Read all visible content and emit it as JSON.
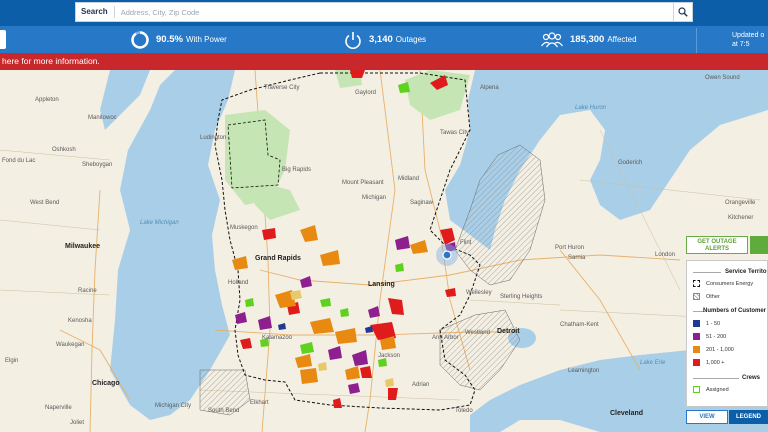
{
  "search": {
    "label": "Search",
    "placeholder": "Address, City, Zip Code"
  },
  "stats": {
    "power_value": "90.5%",
    "power_label": "With Power",
    "outages_value": "3,140",
    "outages_label": "Outages",
    "affected_value": "185,300",
    "affected_label": "Affected",
    "updated_line1": "Updated o",
    "updated_line2": "at 7:5"
  },
  "alert_text": "here for more information.",
  "map": {
    "labels": [
      {
        "name": "Appleton",
        "cls": ""
      },
      {
        "name": "Oshkosh",
        "cls": ""
      },
      {
        "name": "Fond du Lac",
        "cls": ""
      },
      {
        "name": "Sheboygan",
        "cls": ""
      },
      {
        "name": "West Bend",
        "cls": ""
      },
      {
        "name": "Milwaukee",
        "cls": "city"
      },
      {
        "name": "Racine",
        "cls": ""
      },
      {
        "name": "Kenosha",
        "cls": ""
      },
      {
        "name": "Waukegan",
        "cls": ""
      },
      {
        "name": "Elgin",
        "cls": ""
      },
      {
        "name": "Naperville",
        "cls": ""
      },
      {
        "name": "Chicago",
        "cls": "city"
      },
      {
        "name": "Joliet",
        "cls": ""
      },
      {
        "name": "Manitowoc",
        "cls": ""
      },
      {
        "name": "Lake Michigan",
        "cls": "water"
      },
      {
        "name": "Ludington",
        "cls": ""
      },
      {
        "name": "Big Rapids",
        "cls": ""
      },
      {
        "name": "Mount Pleasant",
        "cls": ""
      },
      {
        "name": "Midland",
        "cls": ""
      },
      {
        "name": "Michigan",
        "cls": ""
      },
      {
        "name": "Muskegon",
        "cls": ""
      },
      {
        "name": "Grand Rapids",
        "cls": "city"
      },
      {
        "name": "Holland",
        "cls": ""
      },
      {
        "name": "Lansing",
        "cls": "city"
      },
      {
        "name": "Flint",
        "cls": ""
      },
      {
        "name": "Port Huron",
        "cls": ""
      },
      {
        "name": "Sarnia",
        "cls": ""
      },
      {
        "name": "Wellesley",
        "cls": ""
      },
      {
        "name": "Sterling Heights",
        "cls": ""
      },
      {
        "name": "Westland",
        "cls": ""
      },
      {
        "name": "Detroit",
        "cls": "city"
      },
      {
        "name": "Ann Arbor",
        "cls": ""
      },
      {
        "name": "Kalamazoo",
        "cls": ""
      },
      {
        "name": "Jackson",
        "cls": ""
      },
      {
        "name": "Adrian",
        "cls": ""
      },
      {
        "name": "Toledo",
        "cls": ""
      },
      {
        "name": "South Bend",
        "cls": ""
      },
      {
        "name": "Elkhart",
        "cls": ""
      },
      {
        "name": "Michigan City",
        "cls": ""
      },
      {
        "name": "Chatham-Kent",
        "cls": ""
      },
      {
        "name": "Leamington",
        "cls": ""
      },
      {
        "name": "London",
        "cls": ""
      },
      {
        "name": "Goderich",
        "cls": ""
      },
      {
        "name": "Owen Sound",
        "cls": ""
      },
      {
        "name": "Orangeville",
        "cls": ""
      },
      {
        "name": "Kitchener",
        "cls": ""
      },
      {
        "name": "Cleveland",
        "cls": "city"
      },
      {
        "name": "Lake Huron",
        "cls": "water"
      },
      {
        "name": "Lake Erie",
        "cls": "water"
      },
      {
        "name": "Traverse City",
        "cls": ""
      },
      {
        "name": "Alpena",
        "cls": ""
      },
      {
        "name": "Gaylord",
        "cls": ""
      },
      {
        "name": "Saginaw",
        "cls": ""
      },
      {
        "name": "Tawas City",
        "cls": ""
      }
    ]
  },
  "buttons": {
    "alerts_line1": "GET OUTAGE",
    "alerts_line2": "ALERTS",
    "view": "VIEW",
    "legend": "LEGEND"
  },
  "legend": {
    "service_territory": "Service Territo",
    "consumers": "Consumers Energy",
    "other": "Other",
    "numbers": "Numbers of Customer",
    "ranges": [
      "1 - 50",
      "51 - 200",
      "201 - 1,000",
      "1,000 +"
    ],
    "range_colors": [
      "#1f3a93",
      "#8e1f8e",
      "#e88a12",
      "#e01b1b"
    ],
    "crews": "Crews",
    "assigned": "Assigned"
  },
  "colors": {
    "accent": "#2778c7",
    "banner": "#c8282c",
    "crew": "#5fd11f",
    "lake": "#a9cfe8"
  }
}
